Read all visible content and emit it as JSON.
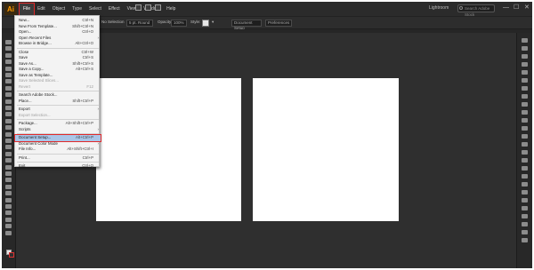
{
  "app": {
    "logo_text": "Ai",
    "accent_color": "#ff9a00",
    "highlight_color": "#e12a2a"
  },
  "menubar": {
    "items": [
      {
        "label": "File",
        "active": true
      },
      {
        "label": "Edit"
      },
      {
        "label": "Object"
      },
      {
        "label": "Type"
      },
      {
        "label": "Select"
      },
      {
        "label": "Effect"
      },
      {
        "label": "View"
      },
      {
        "label": "Window"
      },
      {
        "label": "Help"
      }
    ],
    "right_text": "Lightroom",
    "search_placeholder": "Search Adobe Stock",
    "window_buttons": {
      "minimize": "—",
      "maximize": "☐",
      "close": "✕"
    }
  },
  "control_bar": {
    "selection_label": "No Selection",
    "style_value": "5 pt. Round",
    "opacity_label": "Opacity:",
    "opacity_value": "100%",
    "style_label": "Style:",
    "doc_setup_button": "Document Setup",
    "preferences_button": "Preferences"
  },
  "file_menu": {
    "items": [
      {
        "label": "New...",
        "shortcut": "Ctrl+N"
      },
      {
        "label": "New From Template...",
        "shortcut": "Shift+Ctrl+N"
      },
      {
        "label": "Open...",
        "shortcut": "Ctrl+O"
      },
      {
        "label": "Open Recent Files",
        "submenu": true
      },
      {
        "label": "Browse in Bridge...",
        "shortcut": "Alt+Ctrl+O"
      },
      {
        "separator": true
      },
      {
        "label": "Close",
        "shortcut": "Ctrl+W"
      },
      {
        "label": "Save",
        "shortcut": "Ctrl+S"
      },
      {
        "label": "Save As...",
        "shortcut": "Shift+Ctrl+S"
      },
      {
        "label": "Save a Copy...",
        "shortcut": "Alt+Ctrl+S"
      },
      {
        "label": "Save as Template..."
      },
      {
        "label": "Save Selected Slices...",
        "disabled": true
      },
      {
        "label": "Revert",
        "shortcut": "F12",
        "disabled": true
      },
      {
        "separator": true
      },
      {
        "label": "Search Adobe Stock..."
      },
      {
        "label": "Place...",
        "shortcut": "Shift+Ctrl+P"
      },
      {
        "separator": true
      },
      {
        "label": "Export",
        "submenu": true
      },
      {
        "label": "Export Selection...",
        "disabled": true
      },
      {
        "separator": true
      },
      {
        "label": "Package...",
        "shortcut": "Alt+Shift+Ctrl+P"
      },
      {
        "label": "Scripts",
        "submenu": true
      },
      {
        "separator": true
      },
      {
        "label": "Document Setup...",
        "shortcut": "Alt+Ctrl+P",
        "highlight": true
      },
      {
        "label": "Document Color Mode",
        "submenu": true
      },
      {
        "label": "File Info...",
        "shortcut": "Alt+Shift+Ctrl+I"
      },
      {
        "separator": true
      },
      {
        "label": "Print...",
        "shortcut": "Ctrl+P"
      },
      {
        "separator": true
      },
      {
        "label": "Exit",
        "shortcut": "Ctrl+Q"
      }
    ]
  }
}
